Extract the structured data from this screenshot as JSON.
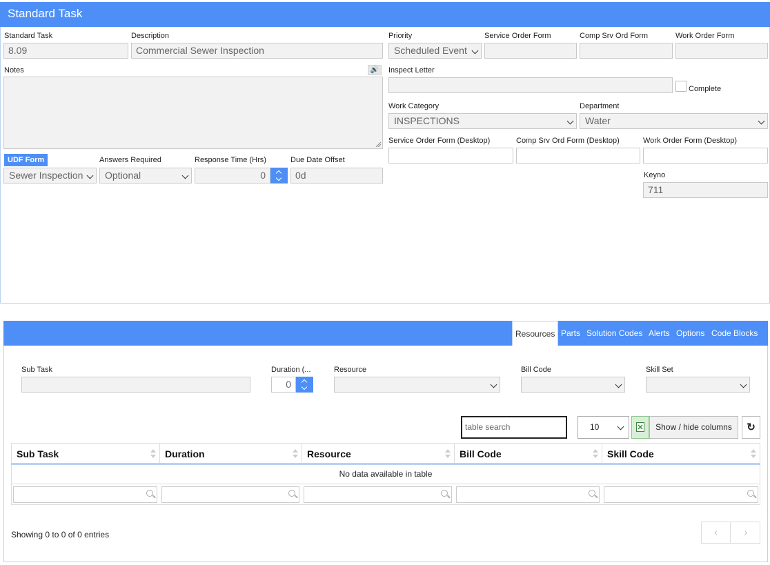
{
  "header": {
    "title": "Standard Task"
  },
  "form": {
    "standard_task": {
      "label": "Standard Task",
      "value": "8.09"
    },
    "description": {
      "label": "Description",
      "value": "Commercial Sewer Inspection"
    },
    "notes": {
      "label": "Notes",
      "value": ""
    },
    "udf_form": {
      "label": "UDF Form",
      "value": "Sewer Inspection"
    },
    "answers_required": {
      "label": "Answers Required",
      "value": "Optional"
    },
    "response_time": {
      "label": "Response Time (Hrs)",
      "value": "0"
    },
    "due_date_offset": {
      "label": "Due Date Offset",
      "value": "0d"
    },
    "priority": {
      "label": "Priority",
      "value": "Scheduled Event"
    },
    "service_order_form": {
      "label": "Service Order Form",
      "value": ""
    },
    "comp_srv_ord_form": {
      "label": "Comp Srv Ord Form",
      "value": ""
    },
    "work_order_form": {
      "label": "Work Order Form",
      "value": ""
    },
    "inspect_letter": {
      "label": "Inspect Letter",
      "value": ""
    },
    "complete": {
      "label": "Complete",
      "checked": false
    },
    "work_category": {
      "label": "Work Category",
      "value": "INSPECTIONS"
    },
    "department": {
      "label": "Department",
      "value": "Water"
    },
    "service_order_form_desktop": {
      "label": "Service Order Form (Desktop)",
      "value": ""
    },
    "comp_srv_ord_form_desktop": {
      "label": "Comp Srv Ord Form (Desktop)",
      "value": ""
    },
    "work_order_form_desktop": {
      "label": "Work Order Form (Desktop)",
      "value": ""
    },
    "keyno": {
      "label": "Keyno",
      "value": "711"
    }
  },
  "tabs": [
    {
      "label": "Resources",
      "active": true
    },
    {
      "label": "Parts"
    },
    {
      "label": "Solution Codes"
    },
    {
      "label": "Alerts"
    },
    {
      "label": "Options"
    },
    {
      "label": "Code Blocks"
    }
  ],
  "resources": {
    "sub_task": {
      "label": "Sub Task",
      "value": ""
    },
    "duration": {
      "label": "Duration (...",
      "value": "0"
    },
    "resource": {
      "label": "Resource",
      "value": ""
    },
    "bill_code": {
      "label": "Bill Code",
      "value": ""
    },
    "skill_set": {
      "label": "Skill Set",
      "value": ""
    }
  },
  "table": {
    "search_placeholder": "table search",
    "page_length": "10",
    "show_hide_label": "Show / hide columns",
    "columns": [
      "Sub Task",
      "Duration",
      "Resource",
      "Bill Code",
      "Skill Code"
    ],
    "empty_message": "No data available in table",
    "info": "Showing 0 to 0 of 0 entries",
    "prev": "‹",
    "next": "›"
  },
  "icons": {
    "speaker": "speaker-icon",
    "excel": "excel-icon",
    "reset": "↻"
  },
  "colors": {
    "accent": "#4d8ff7",
    "panel_border": "#b9d2f3"
  }
}
